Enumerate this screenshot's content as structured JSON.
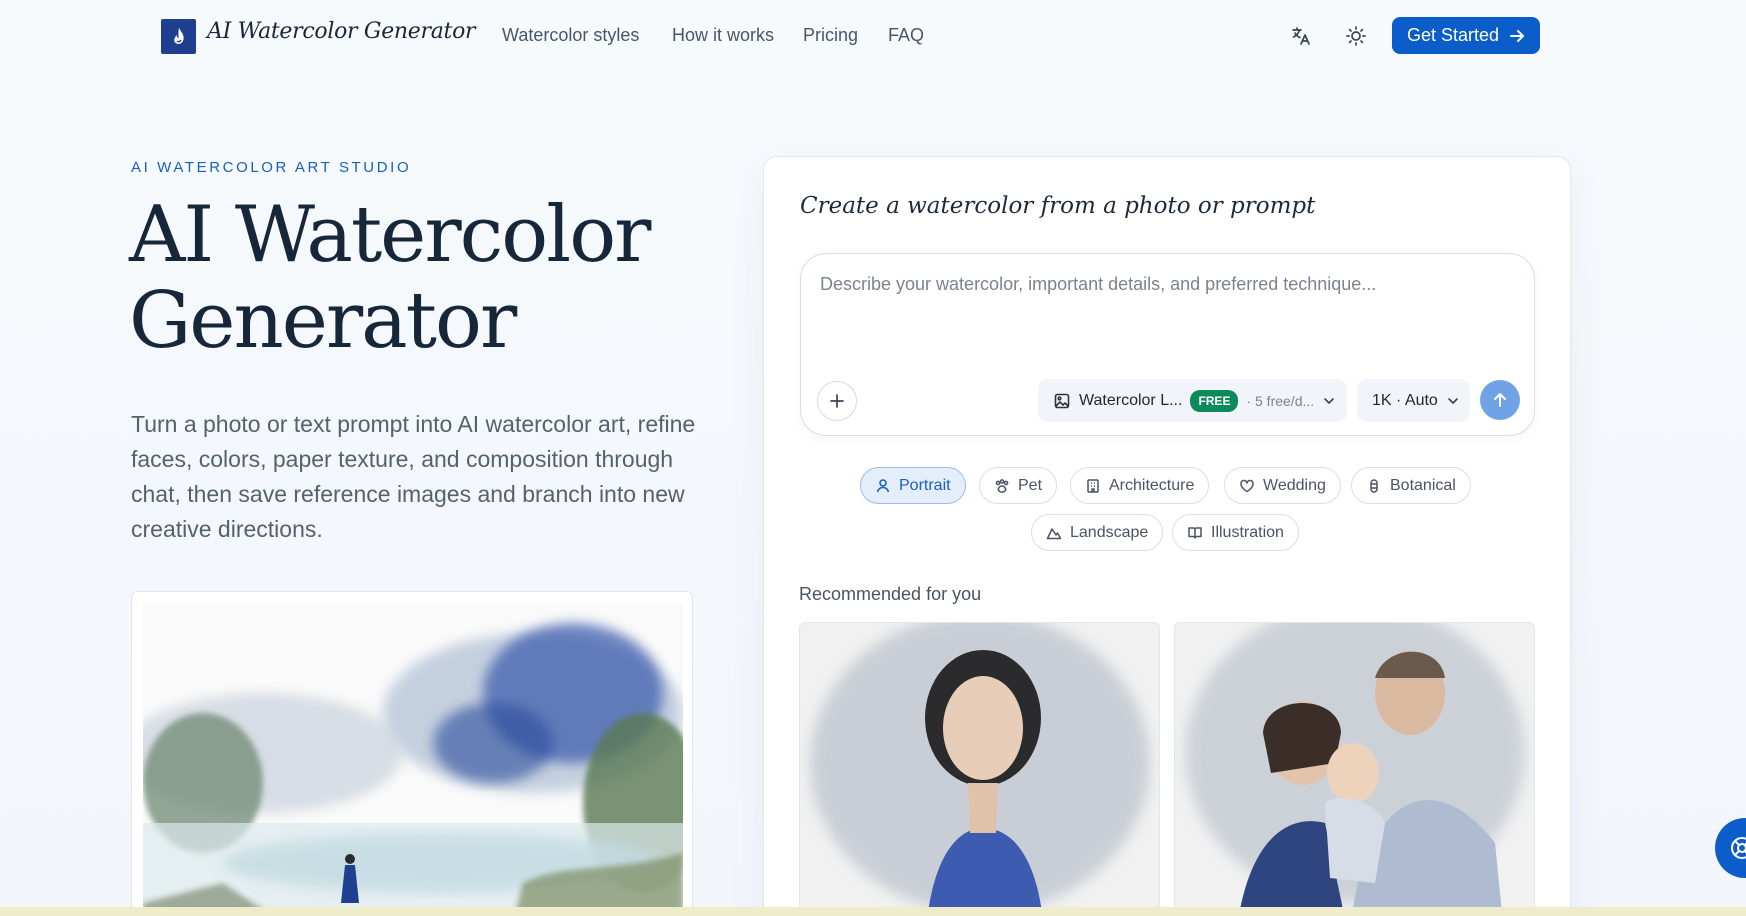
{
  "nav": {
    "logo_text": "AI Watercolor Generator",
    "links": [
      "Watercolor styles",
      "How it works",
      "Pricing",
      "FAQ"
    ],
    "translate_icon": "translate-icon",
    "theme_icon": "sun-icon",
    "cta": "Get Started"
  },
  "hero": {
    "eyebrow": "AI WATERCOLOR ART STUDIO",
    "title_line1": "AI Watercolor",
    "title_line2": "Generator",
    "description": "Turn a photo or text prompt into AI watercolor art, refine faces, colors, paper texture, and composition through chat, then save reference images and branch into new creative directions."
  },
  "panel": {
    "title": "Create a watercolor from a photo or prompt",
    "prompt_placeholder": "Describe your watercolor, important details, and preferred technique...",
    "model_label": "Watercolor L...",
    "free_badge": "FREE",
    "free_count": "· 5 free/d...",
    "resolution": "1K · Auto",
    "chips": [
      "Portrait",
      "Pet",
      "Architecture",
      "Wedding",
      "Botanical",
      "Landscape",
      "Illustration"
    ],
    "active_chip": "Portrait",
    "recommended_label": "Recommended for you"
  },
  "colors": {
    "accent": "#0b5ec9",
    "eyebrow": "#1663b6",
    "free_badge": "#0d8a5c",
    "send_button": "#6fa3e6"
  }
}
